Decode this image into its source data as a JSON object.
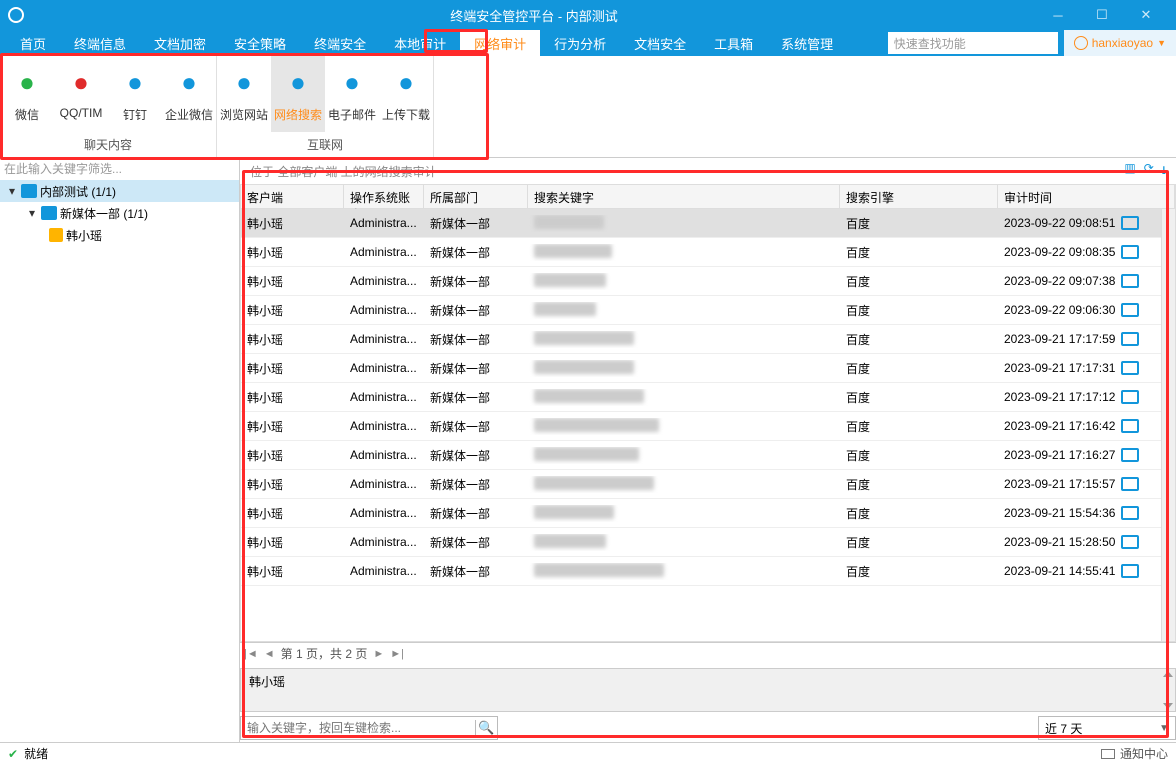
{
  "window": {
    "title": "终端安全管控平台 - 内部测试"
  },
  "menu": {
    "items": [
      "首页",
      "终端信息",
      "文档加密",
      "安全策略",
      "终端安全",
      "本地审计",
      "网络审计",
      "行为分析",
      "文档安全",
      "工具箱",
      "系统管理"
    ],
    "active_index": 6,
    "search_placeholder": "快速查找功能",
    "user": "hanxiaoyao"
  },
  "ribbon": {
    "groups": [
      {
        "label": "聊天内容",
        "items": [
          {
            "name": "wechat",
            "label": "微信",
            "color": "#29b34a"
          },
          {
            "name": "qqtim",
            "label": "QQ/TIM",
            "color": "#e02b2b"
          },
          {
            "name": "dingtalk",
            "label": "钉钉",
            "color": "#1296db"
          },
          {
            "name": "wecom",
            "label": "企业微信",
            "color": "#1296db"
          }
        ]
      },
      {
        "label": "互联网",
        "items": [
          {
            "name": "browse",
            "label": "浏览网站",
            "color": "#1296db"
          },
          {
            "name": "netsearch",
            "label": "网络搜索",
            "color": "#1296db",
            "selected": true
          },
          {
            "name": "email",
            "label": "电子邮件",
            "color": "#1296db"
          },
          {
            "name": "updown",
            "label": "上传下载",
            "color": "#1296db"
          }
        ]
      }
    ]
  },
  "tree": {
    "filter_placeholder": "在此输入关键字筛选...",
    "nodes": [
      {
        "label": "内部测试 (1/1)",
        "level": 0,
        "icon": "people",
        "selected": true
      },
      {
        "label": "新媒体一部 (1/1)",
        "level": 1,
        "icon": "people"
      },
      {
        "label": "韩小瑶",
        "level": 2,
        "icon": "user-y"
      }
    ]
  },
  "breadcrumb": "位于 全部客户端 上的网络搜索审计",
  "columns": [
    "客户端",
    "操作系统账户",
    "所属部门",
    "搜索关键字",
    "搜索引擎",
    "审计时间"
  ],
  "rows": [
    {
      "client": "韩小瑶",
      "acct": "Administra...",
      "dept": "新媒体一部",
      "engine": "百度",
      "time": "2023-09-22 09:08:51",
      "kw_w": 70,
      "sel": true
    },
    {
      "client": "韩小瑶",
      "acct": "Administra...",
      "dept": "新媒体一部",
      "engine": "百度",
      "time": "2023-09-22 09:08:35",
      "kw_w": 78
    },
    {
      "client": "韩小瑶",
      "acct": "Administra...",
      "dept": "新媒体一部",
      "engine": "百度",
      "time": "2023-09-22 09:07:38",
      "kw_w": 72
    },
    {
      "client": "韩小瑶",
      "acct": "Administra...",
      "dept": "新媒体一部",
      "engine": "百度",
      "time": "2023-09-22 09:06:30",
      "kw_w": 62
    },
    {
      "client": "韩小瑶",
      "acct": "Administra...",
      "dept": "新媒体一部",
      "engine": "百度",
      "time": "2023-09-21 17:17:59",
      "kw_w": 100
    },
    {
      "client": "韩小瑶",
      "acct": "Administra...",
      "dept": "新媒体一部",
      "engine": "百度",
      "time": "2023-09-21 17:17:31",
      "kw_w": 100
    },
    {
      "client": "韩小瑶",
      "acct": "Administra...",
      "dept": "新媒体一部",
      "engine": "百度",
      "time": "2023-09-21 17:17:12",
      "kw_w": 110
    },
    {
      "client": "韩小瑶",
      "acct": "Administra...",
      "dept": "新媒体一部",
      "engine": "百度",
      "time": "2023-09-21 17:16:42",
      "kw_w": 125
    },
    {
      "client": "韩小瑶",
      "acct": "Administra...",
      "dept": "新媒体一部",
      "engine": "百度",
      "time": "2023-09-21 17:16:27",
      "kw_w": 105
    },
    {
      "client": "韩小瑶",
      "acct": "Administra...",
      "dept": "新媒体一部",
      "engine": "百度",
      "time": "2023-09-21 17:15:57",
      "kw_w": 120
    },
    {
      "client": "韩小瑶",
      "acct": "Administra...",
      "dept": "新媒体一部",
      "engine": "百度",
      "time": "2023-09-21 15:54:36",
      "kw_w": 80
    },
    {
      "client": "韩小瑶",
      "acct": "Administra...",
      "dept": "新媒体一部",
      "engine": "百度",
      "time": "2023-09-21 15:28:50",
      "kw_w": 72
    },
    {
      "client": "韩小瑶",
      "acct": "Administra...",
      "dept": "新媒体一部",
      "engine": "百度",
      "time": "2023-09-21 14:55:41",
      "kw_w": 130
    }
  ],
  "pager": "第 1 页，共 2 页",
  "preview_text": "韩小瑶",
  "filter": {
    "placeholder": "输入关键字，按回车键检索...",
    "range": "近 7 天"
  },
  "status": {
    "text": "就绪",
    "right": "通知中心"
  }
}
